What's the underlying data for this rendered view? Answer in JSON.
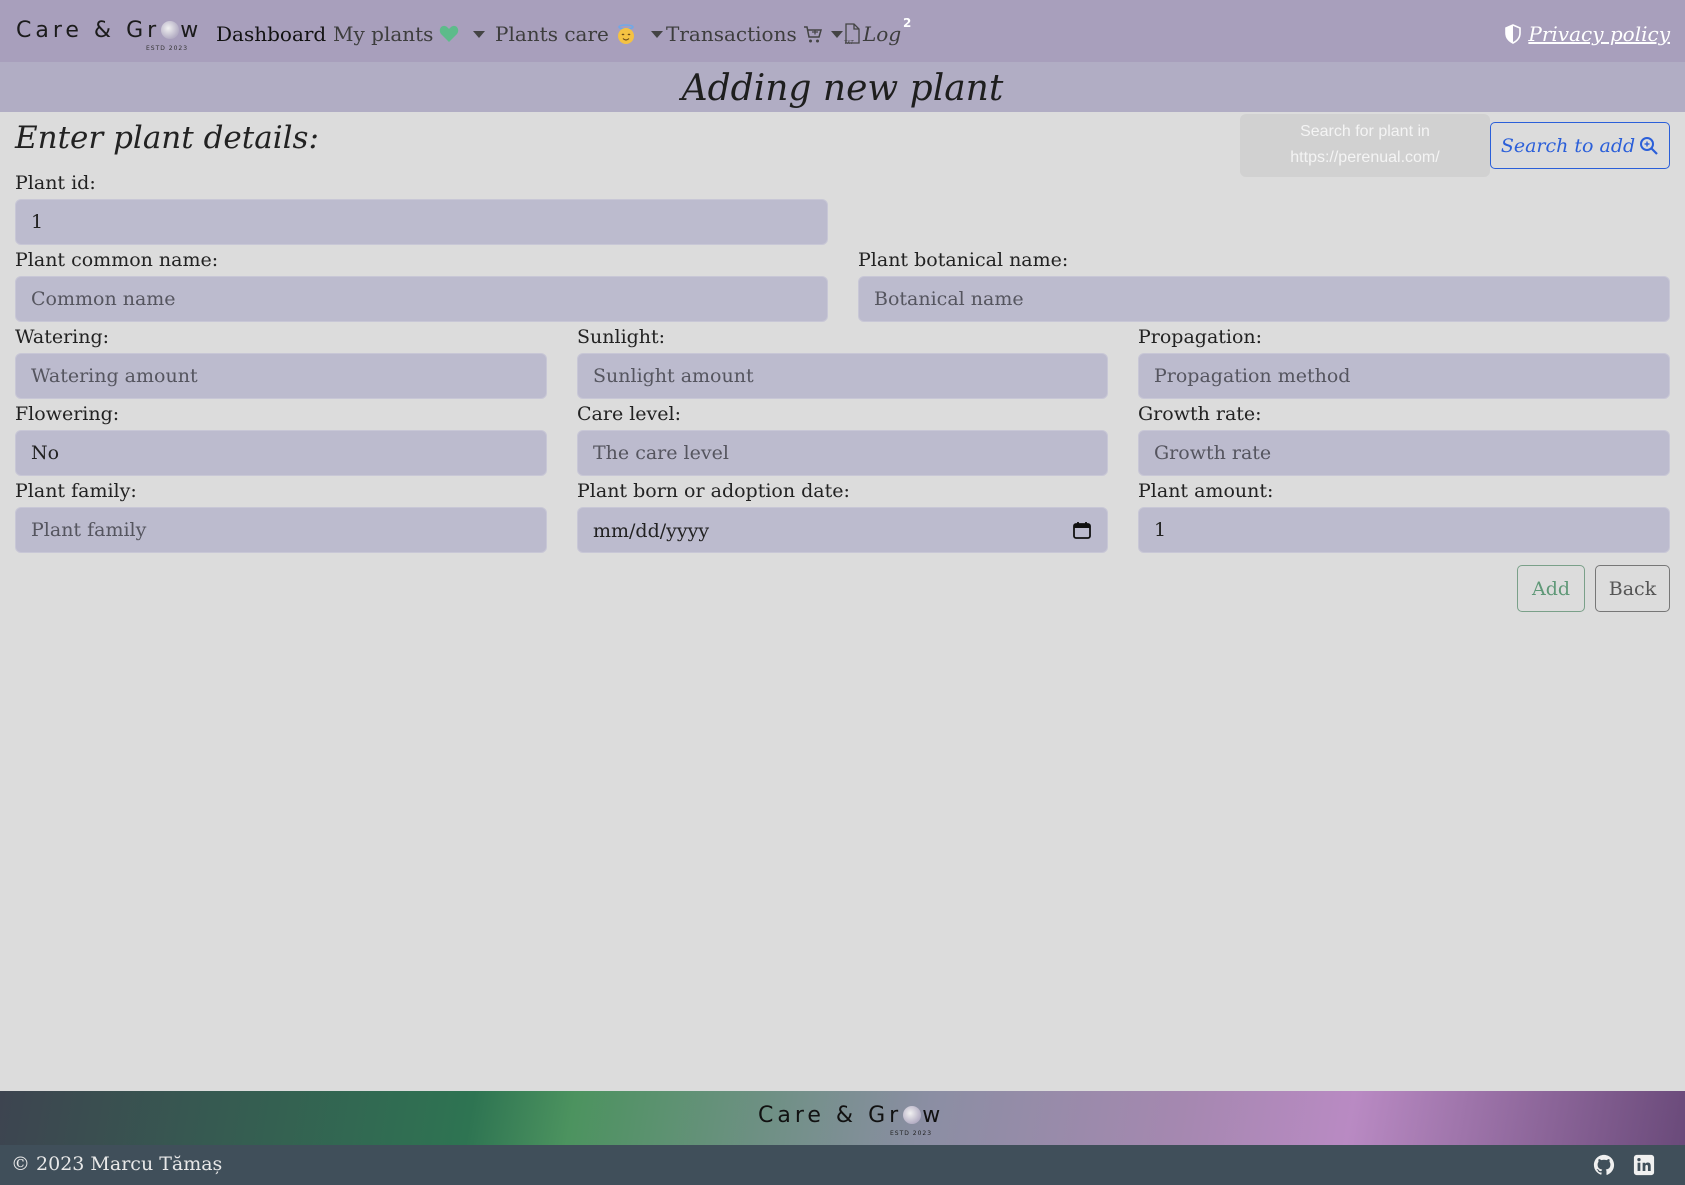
{
  "navbar": {
    "brand": "Care & Gr",
    "brand_suffix": "w",
    "brand_estd": "ESTD 2023",
    "items": [
      {
        "label": "Dashboard"
      },
      {
        "label": "My plants"
      },
      {
        "label": "Plants care"
      },
      {
        "label": "Transactions"
      },
      {
        "label": "Log"
      }
    ],
    "log_badge": "2",
    "privacy_label": "Privacy policy"
  },
  "page": {
    "title": "Adding new plant",
    "section_heading": "Enter plant details:",
    "search_hint_line1": "Search for plant in",
    "search_hint_line2": "https://perenual.com/",
    "search_button": "Search to add"
  },
  "form": {
    "plant_id": {
      "label": "Plant id:",
      "value": "1"
    },
    "common_name": {
      "label": "Plant common name:",
      "placeholder": "Common name"
    },
    "botanical_name": {
      "label": "Plant botanical name:",
      "placeholder": "Botanical name"
    },
    "watering": {
      "label": "Watering:",
      "placeholder": "Watering amount"
    },
    "sunlight": {
      "label": "Sunlight:",
      "placeholder": "Sunlight amount"
    },
    "propagation": {
      "label": "Propagation:",
      "placeholder": "Propagation method"
    },
    "flowering": {
      "label": "Flowering:",
      "value": "No"
    },
    "care_level": {
      "label": "Care level:",
      "placeholder": "The care level"
    },
    "growth_rate": {
      "label": "Growth rate:",
      "placeholder": "Growth rate"
    },
    "plant_family": {
      "label": "Plant family:",
      "placeholder": "Plant family"
    },
    "adoption_date": {
      "label": "Plant born or adoption date:",
      "placeholder": "mm/dd/yyyy"
    },
    "plant_amount": {
      "label": "Plant amount:",
      "value": "1"
    },
    "add_button": "Add",
    "back_button": "Back"
  },
  "footer": {
    "brand": "Care & Gr",
    "brand_suffix": "w",
    "brand_estd": "ESTD 2023",
    "copyright": "© 2023 Marcu Tămaș"
  },
  "colors": {
    "navbar_bg": "#a89fbc",
    "title_band_bg": "#b1adc4",
    "page_bg": "#dcdcdc",
    "input_bg": "#bcbbce",
    "search_button": "#2b5fd9",
    "add_button": "#5f9877",
    "footer_bar": "#404f5a"
  }
}
